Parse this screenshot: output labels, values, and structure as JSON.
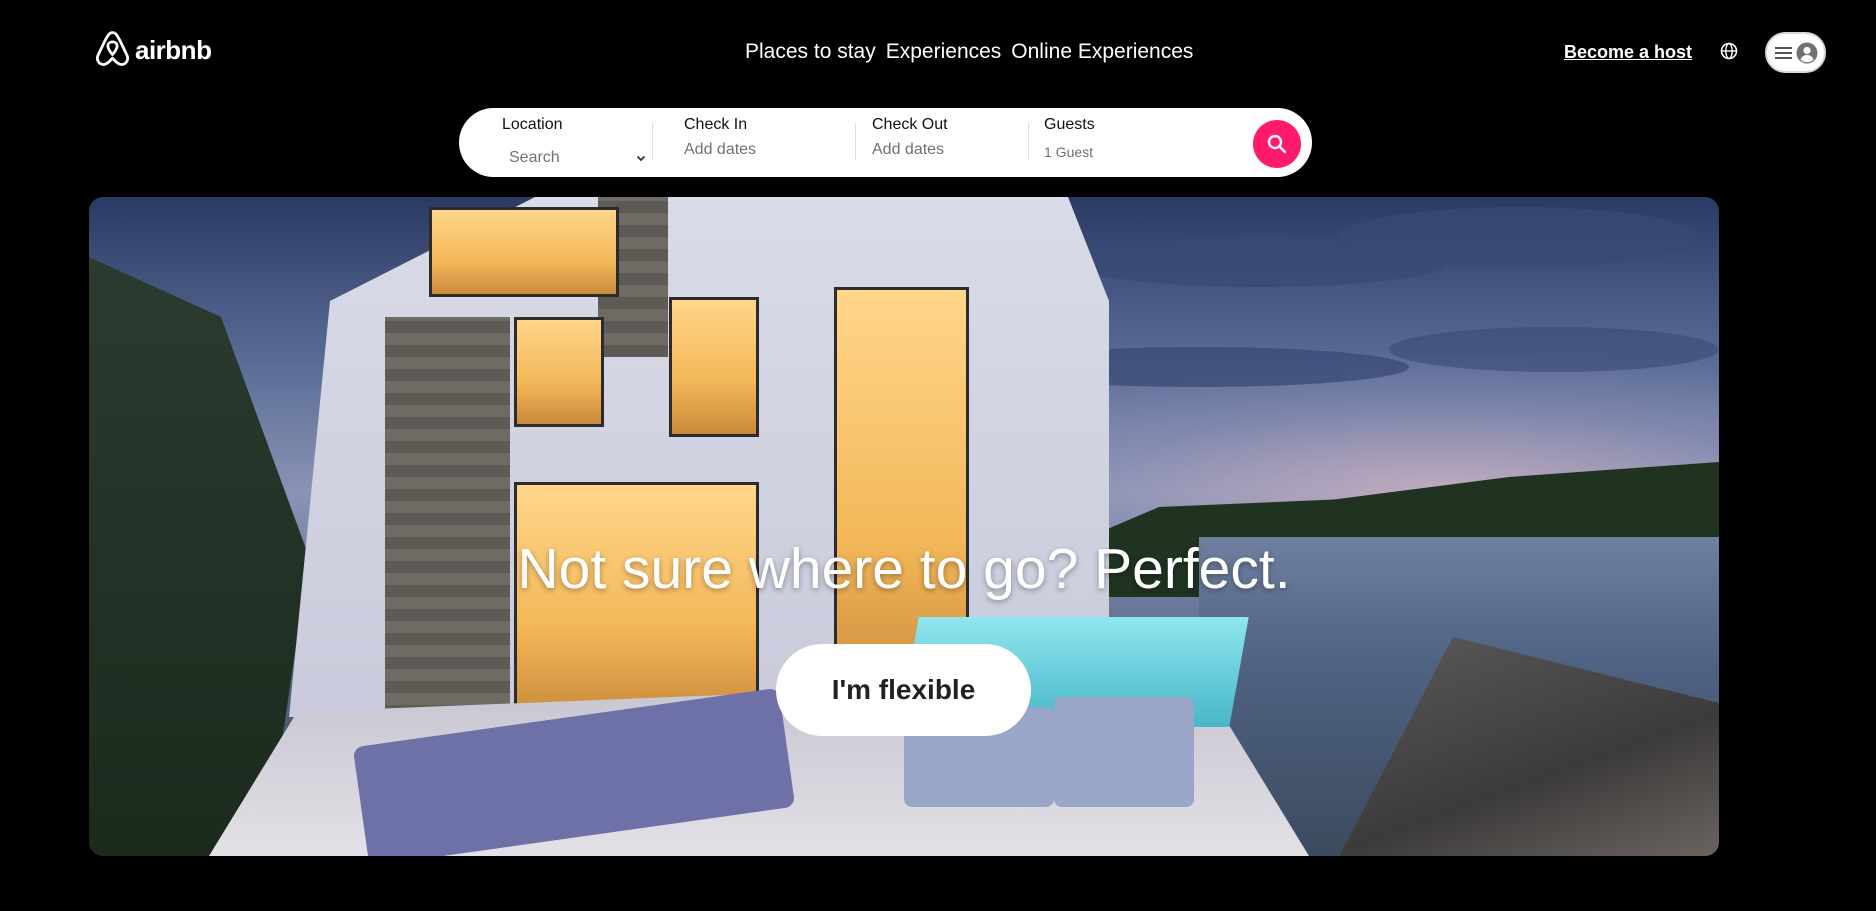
{
  "header": {
    "logo_text": "airbnb",
    "logo_icon": "airbnb-belo-icon",
    "nav": [
      {
        "label": "Places to stay"
      },
      {
        "label": "Experiences"
      },
      {
        "label": "Online Experiences"
      }
    ],
    "become_host_label": "Become a host",
    "globe_icon": "globe-icon",
    "menu_icon": "hamburger-icon",
    "avatar_icon": "user-avatar-icon"
  },
  "search": {
    "location": {
      "label": "Location",
      "value": "Search"
    },
    "check_in": {
      "label": "Check In",
      "placeholder": "Add dates"
    },
    "check_out": {
      "label": "Check Out",
      "placeholder": "Add dates"
    },
    "guests": {
      "label": "Guests",
      "value": "1 Guest"
    },
    "button_icon": "search-icon",
    "accent_color": "#ff1a6b"
  },
  "hero": {
    "title": "Not sure where to go? Perfect.",
    "cta_label": "I'm flexible"
  }
}
